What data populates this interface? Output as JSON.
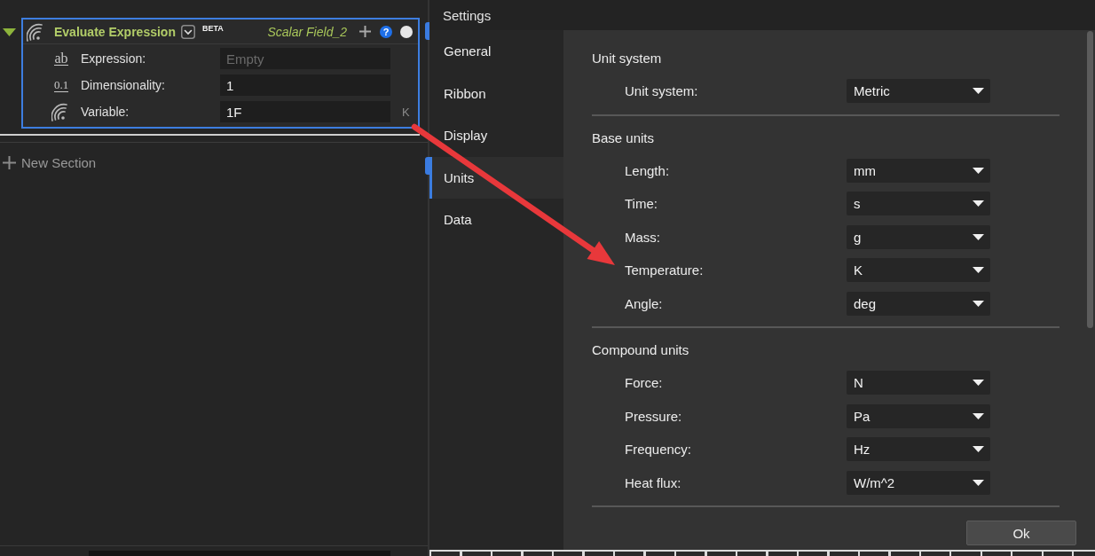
{
  "node_panel": {
    "nodes": [
      {
        "title": "Evaluate Expression",
        "badge": "BETA",
        "output": "Scalar Field_2",
        "help": "?",
        "expanded": true,
        "selected": true,
        "params": [
          {
            "kind": "text",
            "glyph": "ab",
            "label": "Expression:",
            "placeholder": "Empty"
          },
          {
            "kind": "number",
            "glyph": "0.1",
            "label": "Dimensionality:",
            "value": "1"
          },
          {
            "kind": "field",
            "label": "Variable:",
            "value": "1F",
            "unit": "K"
          }
        ]
      }
    ],
    "new_section": {
      "label": "New Section"
    }
  },
  "dialog": {
    "title": "Settings",
    "nav": [
      {
        "label": "General",
        "selected": false
      },
      {
        "label": "Ribbon",
        "selected": false
      },
      {
        "label": "Display",
        "selected": false
      },
      {
        "label": "Units",
        "selected": true
      },
      {
        "label": "Data",
        "selected": false
      }
    ],
    "sections": [
      {
        "title": "Unit system",
        "rows": [
          {
            "label": "Unit system:",
            "value": "Metric"
          }
        ]
      },
      {
        "title": "Base units",
        "rows": [
          {
            "label": "Length:",
            "value": "mm"
          },
          {
            "label": "Time:",
            "value": "s"
          },
          {
            "label": "Mass:",
            "value": "g"
          },
          {
            "label": "Temperature:",
            "value": "K"
          },
          {
            "label": "Angle:",
            "value": "deg"
          }
        ]
      },
      {
        "title": "Compound units",
        "rows": [
          {
            "label": "Force:",
            "value": "N"
          },
          {
            "label": "Pressure:",
            "value": "Pa"
          },
          {
            "label": "Frequency:",
            "value": "Hz"
          },
          {
            "label": "Heat flux:",
            "value": "W/m^2"
          }
        ]
      }
    ],
    "ok_button": "Ok"
  },
  "annotation": {
    "kind": "arrow"
  }
}
